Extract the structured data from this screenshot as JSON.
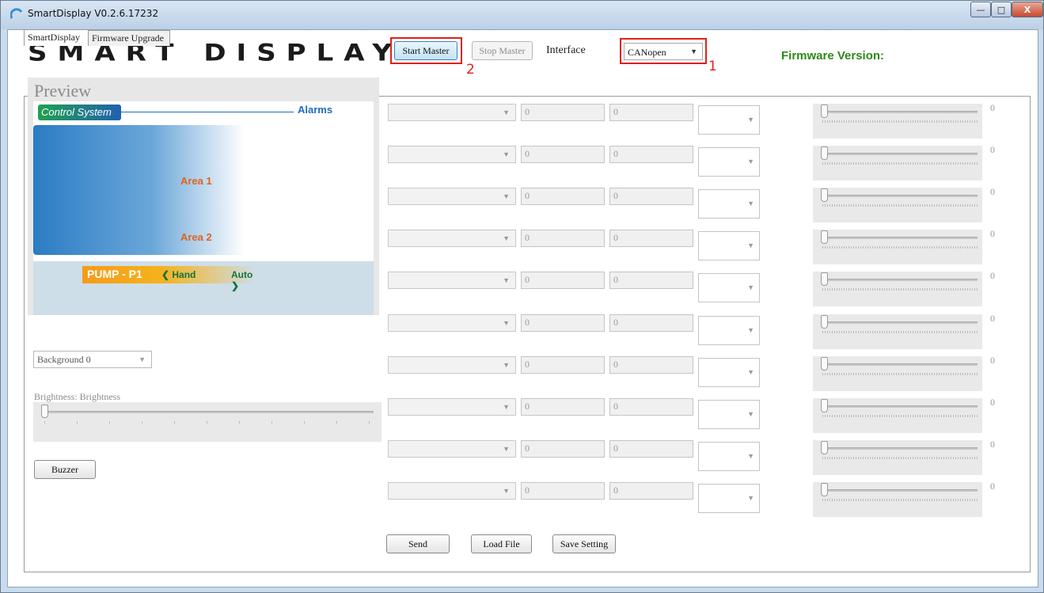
{
  "window": {
    "title": "SmartDisplay V0.2.6.17232",
    "min_label": "—",
    "max_label": "□",
    "close_label": "X"
  },
  "header": {
    "logo": "SMART DISPLAY",
    "start_master": "Start Master",
    "stop_master": "Stop Master",
    "interface_label": "Interface",
    "interface_value": "CANopen",
    "firmware_label": "Firmware Version:",
    "annotation_1": "1",
    "annotation_2": "2"
  },
  "tabs": [
    {
      "label": "SmartDisplay",
      "active": true
    },
    {
      "label": "Firmware Upgrade",
      "active": false
    }
  ],
  "preview": {
    "title": "Preview",
    "control_system": "Control System",
    "alarms": "Alarms",
    "area1": "Area 1",
    "area2": "Area 2",
    "pump": "PUMP - P1",
    "hand": "❮ Hand",
    "auto": "Auto ❯"
  },
  "left": {
    "background_select": "Background 0",
    "brightness_label": "Brightness:  Brightness",
    "brightness_value": 0,
    "buzzer": "Buzzer"
  },
  "rows": [
    {
      "a": "0",
      "b": "0",
      "slider": "0"
    },
    {
      "a": "0",
      "b": "0",
      "slider": "0"
    },
    {
      "a": "0",
      "b": "0",
      "slider": "0"
    },
    {
      "a": "0",
      "b": "0",
      "slider": "0"
    },
    {
      "a": "0",
      "b": "0",
      "slider": "0"
    },
    {
      "a": "0",
      "b": "0",
      "slider": "0"
    },
    {
      "a": "0",
      "b": "0",
      "slider": "0"
    },
    {
      "a": "0",
      "b": "0",
      "slider": "0"
    },
    {
      "a": "0",
      "b": "0",
      "slider": "0"
    },
    {
      "a": "0",
      "b": "0",
      "slider": "0"
    }
  ],
  "footer": {
    "send": "Send",
    "load_file": "Load File",
    "save_setting": "Save Setting"
  },
  "colors": {
    "firmware_green": "#2d8a17",
    "annotation_red": "#e0201a",
    "pump_orange": "#f59b1b",
    "area_text": "#e0621e"
  }
}
